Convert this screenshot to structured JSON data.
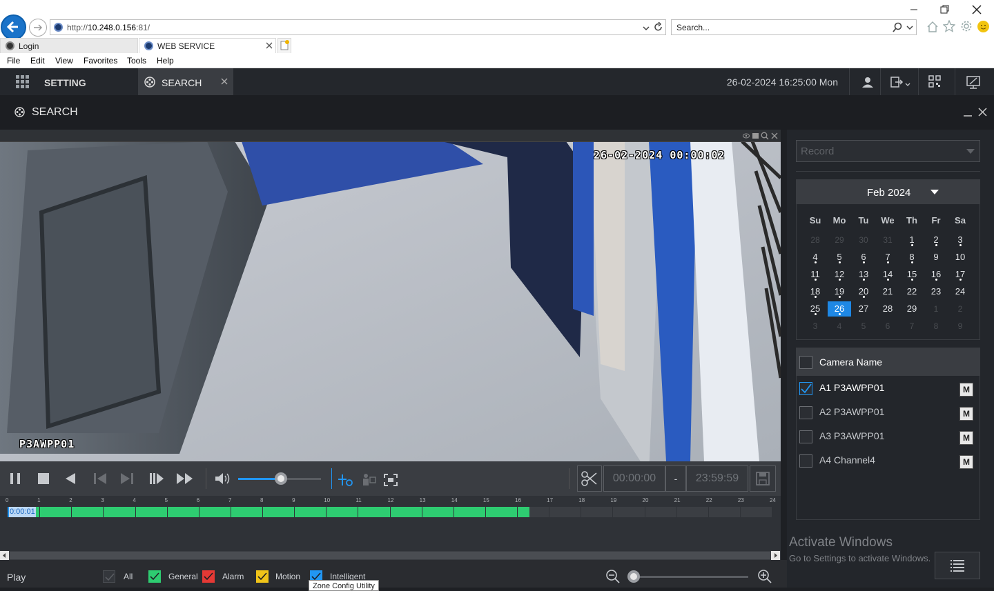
{
  "browser": {
    "url_prefix": "http://",
    "url_host": "10.248.0.156",
    "url_suffix": ":81/",
    "search_placeholder": "Search...",
    "tabs": [
      {
        "label": "Login"
      },
      {
        "label": "WEB SERVICE"
      }
    ],
    "menu": [
      "File",
      "Edit",
      "View",
      "Favorites",
      "Tools",
      "Help"
    ]
  },
  "app": {
    "tab_setting": "SETTING",
    "tab_search": "SEARCH",
    "datetime": "26-02-2024 16:25:00 Mon",
    "panel_title": "SEARCH"
  },
  "video": {
    "osd_timestamp": "26-02-2024 00:00:02",
    "osd_camera": "P3AWPP01"
  },
  "controls": {
    "volume_level": 0.6,
    "clip_start": "00:00:00",
    "clip_sep": "-",
    "clip_end": "23:59:59"
  },
  "timeline": {
    "hours": [
      "0",
      "1",
      "2",
      "3",
      "4",
      "5",
      "6",
      "7",
      "8",
      "9",
      "10",
      "11",
      "12",
      "13",
      "14",
      "15",
      "16",
      "17",
      "18",
      "19",
      "20",
      "21",
      "22",
      "23",
      "24"
    ],
    "current_time": "0:00:01",
    "recorded_until_hour": 16.4,
    "record_color": "#2ecc71"
  },
  "legend": {
    "play_label": "Play",
    "items": [
      {
        "label": "All",
        "color": "#3a3d42"
      },
      {
        "label": "General",
        "color": "#2ecc71"
      },
      {
        "label": "Alarm",
        "color": "#e53935"
      },
      {
        "label": "Motion",
        "color": "#f0c419"
      },
      {
        "label": "Intelligent",
        "color": "#2196f3"
      }
    ],
    "tooltip": "Zone Config Utility"
  },
  "right": {
    "record_type": "Record",
    "month": "Feb 2024",
    "weekdays": [
      "Su",
      "Mo",
      "Tu",
      "We",
      "Th",
      "Fr",
      "Sa"
    ],
    "weeks": [
      [
        "28",
        "29",
        "30",
        "31",
        "1",
        "2",
        "3"
      ],
      [
        "4",
        "5",
        "6",
        "7",
        "8",
        "9",
        "10"
      ],
      [
        "11",
        "12",
        "13",
        "14",
        "15",
        "16",
        "17"
      ],
      [
        "18",
        "19",
        "20",
        "21",
        "22",
        "23",
        "24"
      ],
      [
        "25",
        "26",
        "27",
        "28",
        "29",
        "1",
        "2"
      ],
      [
        "3",
        "4",
        "5",
        "6",
        "7",
        "8",
        "9"
      ]
    ],
    "selected_day": "26",
    "camera_header": "Camera Name",
    "cameras": [
      {
        "name": "A1 P3AWPP01",
        "checked": true,
        "m": "M"
      },
      {
        "name": "A2 P3AWPP01",
        "checked": false,
        "m": "M"
      },
      {
        "name": "A3 P3AWPP01",
        "checked": false,
        "m": "M"
      },
      {
        "name": "A4 Channel4",
        "checked": false,
        "m": "M"
      }
    ],
    "watermark_title": "Activate Windows",
    "watermark_sub": "Go to Settings to activate Windows."
  }
}
